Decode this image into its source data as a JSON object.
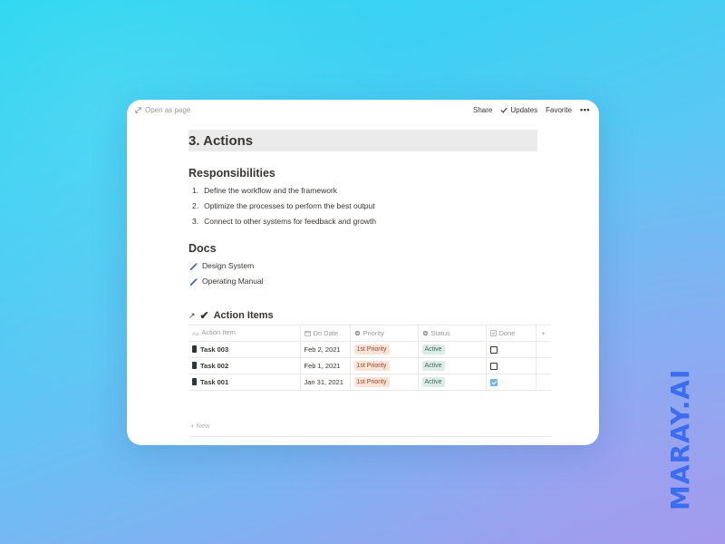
{
  "topbar": {
    "open_as_page": "Open as page",
    "share": "Share",
    "updates": "Updates",
    "favorite": "Favorite",
    "more": "•••"
  },
  "page": {
    "title": "3. Actions"
  },
  "responsibilities": {
    "heading": "Responsibilities",
    "items": [
      {
        "num": "1.",
        "text": "Define the workflow and the framework"
      },
      {
        "num": "2.",
        "text": "Optimize the processes to perform the best output"
      },
      {
        "num": "3.",
        "text": "Connect to other systems for feedback and growth"
      }
    ]
  },
  "docs": {
    "heading": "Docs",
    "items": [
      {
        "text": "Design System"
      },
      {
        "text": "Operating Manual"
      }
    ]
  },
  "database": {
    "arrow": "↗",
    "check": "✔",
    "title": "Action Items",
    "columns": {
      "action_item": "Action Item",
      "do_date": "Do Date",
      "priority": "Priority",
      "status": "Status",
      "done": "Done",
      "add": "+"
    },
    "rows": [
      {
        "task": "Task 003",
        "date": "Feb 2, 2021",
        "priority": "1st Priority",
        "status": "Active",
        "done": false
      },
      {
        "task": "Task 002",
        "date": "Feb 1, 2021",
        "priority": "1st Priority",
        "status": "Active",
        "done": false
      },
      {
        "task": "Task 001",
        "date": "Jan 31, 2021",
        "priority": "1st Priority",
        "status": "Active",
        "done": true
      }
    ],
    "new_label": "+ New"
  },
  "brand": "MARAY.AI",
  "colors": {
    "accent_brand": "#3b6df0",
    "priority_tag_bg": "#fbe4d7",
    "status_tag_bg": "#dcece6",
    "checkbox_checked": "#6fb7e8"
  }
}
